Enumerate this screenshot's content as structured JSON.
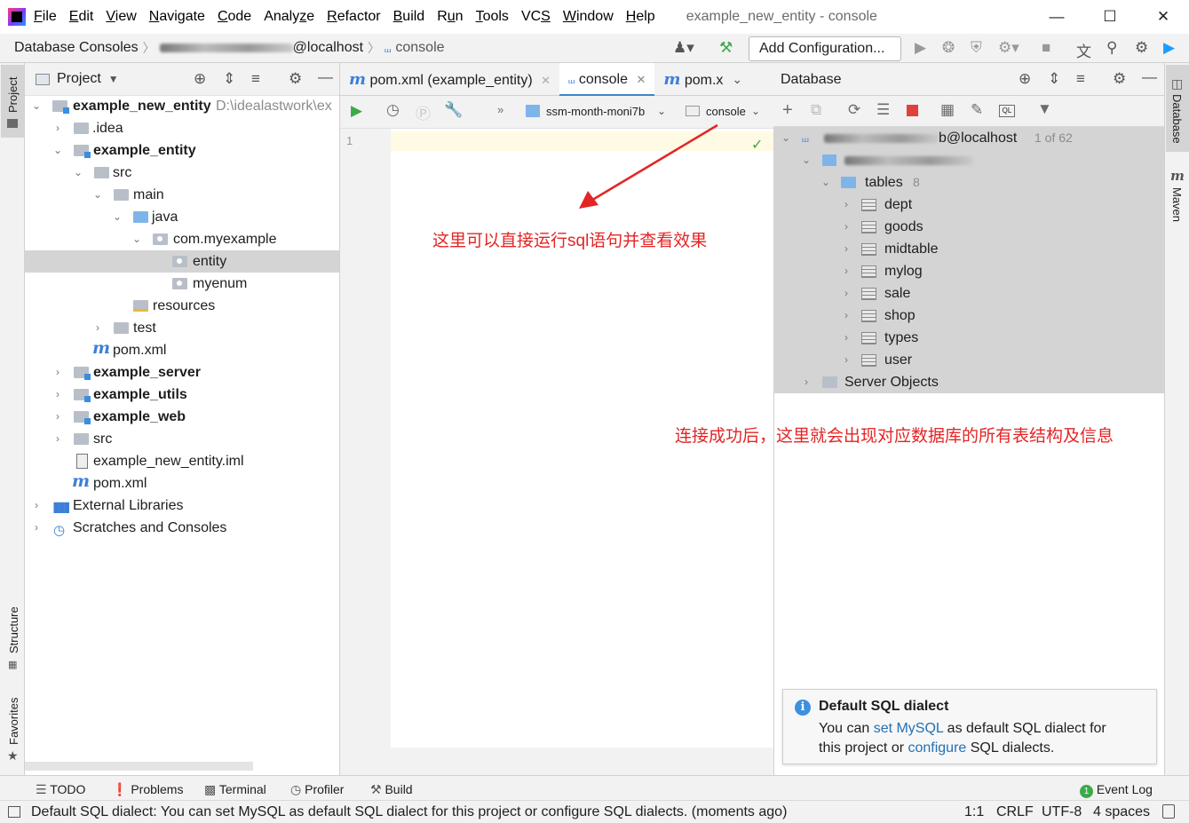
{
  "menu": {
    "items": [
      "File",
      "Edit",
      "View",
      "Navigate",
      "Code",
      "Analyze",
      "Refactor",
      "Build",
      "Run",
      "Tools",
      "VCS",
      "Window",
      "Help"
    ],
    "mnemonics": [
      "F",
      "E",
      "V",
      "N",
      "C",
      "z",
      "R",
      "B",
      "u",
      "T",
      "S",
      "W",
      "H"
    ],
    "window_title": "example_new_entity - console"
  },
  "nav": {
    "crumb1": "Database Consoles",
    "crumb2_suffix": "@localhost",
    "crumb3": "console",
    "add_configuration": "Add Configuration..."
  },
  "project": {
    "header": "Project",
    "root_name": "example_new_entity",
    "root_path": "D:\\idealastwork\\ex",
    "rows": {
      "idea": ".idea",
      "example_entity": "example_entity",
      "src": "src",
      "main": "main",
      "java": "java",
      "com_myexample": "com.myexample",
      "entity": "entity",
      "myenum": "myenum",
      "resources": "resources",
      "test": "test",
      "pom_inner": "pom.xml",
      "example_server": "example_server",
      "example_utils": "example_utils",
      "example_web": "example_web",
      "src_root": "src",
      "iml": "example_new_entity.iml",
      "pom_root": "pom.xml",
      "external_libraries": "External Libraries",
      "scratches": "Scratches and Consoles"
    }
  },
  "editor": {
    "tabs": [
      "pom.xml (example_entity)",
      "console",
      "pom.x"
    ],
    "data_source": "ssm-month-moni7b",
    "console_selector": "console",
    "line_number": "1"
  },
  "database": {
    "header": "Database",
    "connection_suffix": "b@localhost",
    "connection_count": "1 of 62",
    "tables_label": "tables",
    "tables_count": "8",
    "tables": [
      "dept",
      "goods",
      "midtable",
      "mylog",
      "sale",
      "shop",
      "types",
      "user"
    ],
    "server_objects": "Server Objects"
  },
  "annotations": {
    "editor_note": "这里可以直接运行sql语句并查看效果",
    "db_note": "连接成功后，这里就会出现对应数据库的所有表结构及信息"
  },
  "notification": {
    "title": "Default SQL dialect",
    "line1_pre": "You can ",
    "line1_link": "set MySQL",
    "line1_post": " as default SQL dialect for",
    "line2_pre": "this project or ",
    "line2_link": "configure",
    "line2_post": " SQL dialects."
  },
  "side_strips": {
    "left": [
      "Project",
      "Structure",
      "Favorites"
    ],
    "right": [
      "Database",
      "Maven"
    ]
  },
  "toolwindows": [
    "TODO",
    "Problems",
    "Terminal",
    "Profiler",
    "Build",
    "Event Log"
  ],
  "status": {
    "message": "Default SQL dialect: You can set MySQL as default SQL dialect for this project or configure SQL dialects. (moments ago)",
    "position": "1:1",
    "line_sep": "CRLF",
    "encoding": "UTF-8",
    "indent": "4 spaces"
  },
  "colors": {
    "accent": "#4083c9",
    "annotation": "#e32525",
    "run_green": "#3da94a",
    "stop_red": "#e0413c"
  }
}
